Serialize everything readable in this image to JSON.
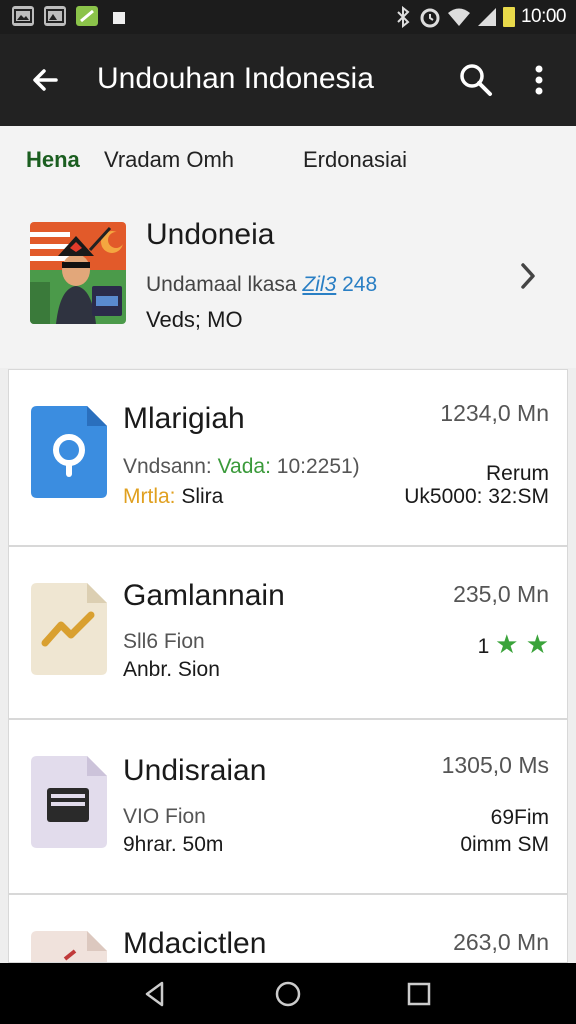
{
  "status_bar": {
    "time": "1ᏀᏀ:ᏀᏀ",
    "time_text": "10:00"
  },
  "toolbar": {
    "title": "Undouhan Indonesia"
  },
  "tabs": [
    {
      "label": "Hena",
      "active": true
    },
    {
      "label": "Vradam Omh",
      "active": false
    },
    {
      "label": "Erdonasiai",
      "active": false
    }
  ],
  "header_app": {
    "title": "Undoneia",
    "sub_prefix": "Undamaal lkasa",
    "sub_link": "Zil3",
    "sub_version": "248",
    "meta": "Veds; MO"
  },
  "cards": [
    {
      "title": "Mlarigiah",
      "size": "1234,0 Mn",
      "sub_prefix": "Vndsann:",
      "sub_green": "Vada:",
      "sub_suffix": "10:2251)",
      "meta_orange": "Mrtla:",
      "meta_rest": "Slira",
      "right1": "Rerum",
      "right2": "Uk5000: 32:SM"
    },
    {
      "title": "Gamlannain",
      "size": "235,0 Mn",
      "sub": "Sll6 Fion",
      "meta": "Anbr. Sion",
      "rating_text": "1",
      "stars": "★ ★"
    },
    {
      "title": "Undisraian",
      "size": "1305,0 Ms",
      "sub": "VIO Fion",
      "meta": "9hrar. 50m",
      "right1": "69Fim",
      "right2": "0imm SM"
    },
    {
      "title": "Mdacictlen",
      "size": "263,0 Mn"
    }
  ],
  "colors": {
    "accent_green": "#1b5e20",
    "toolbar_bg": "#222222",
    "link_blue": "#2a7fc4",
    "star_green": "#3aa33a"
  }
}
